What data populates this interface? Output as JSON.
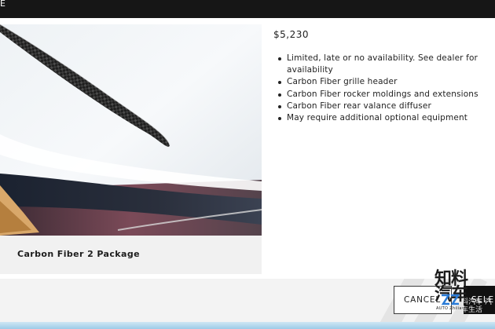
{
  "header": {
    "title_fragment": "E"
  },
  "package": {
    "name": "Carbon Fiber 2 Package",
    "price": "$5,230",
    "features": [
      "Limited, late or no availability. See dealer for availability",
      "Carbon Fiber grille header",
      "Carbon Fiber rocker moldings and extensions",
      "Carbon Fiber rear valance diffuser",
      "May require additional optional equipment"
    ]
  },
  "actions": {
    "cancel_label": "CANCEL",
    "select_label": "SELE"
  },
  "watermark": {
    "line1": "知料",
    "line2": "汽车",
    "auto_text": "AUTO ZhiliaoAuto",
    "cn_text": "料汽车 汽车生活"
  },
  "colors": {
    "topbar": "#161616",
    "card_bg": "#f1f1f1",
    "footer_bg": "#f3f3f3",
    "select_bg": "#111111",
    "accent_blue": "#9dcbe8"
  }
}
